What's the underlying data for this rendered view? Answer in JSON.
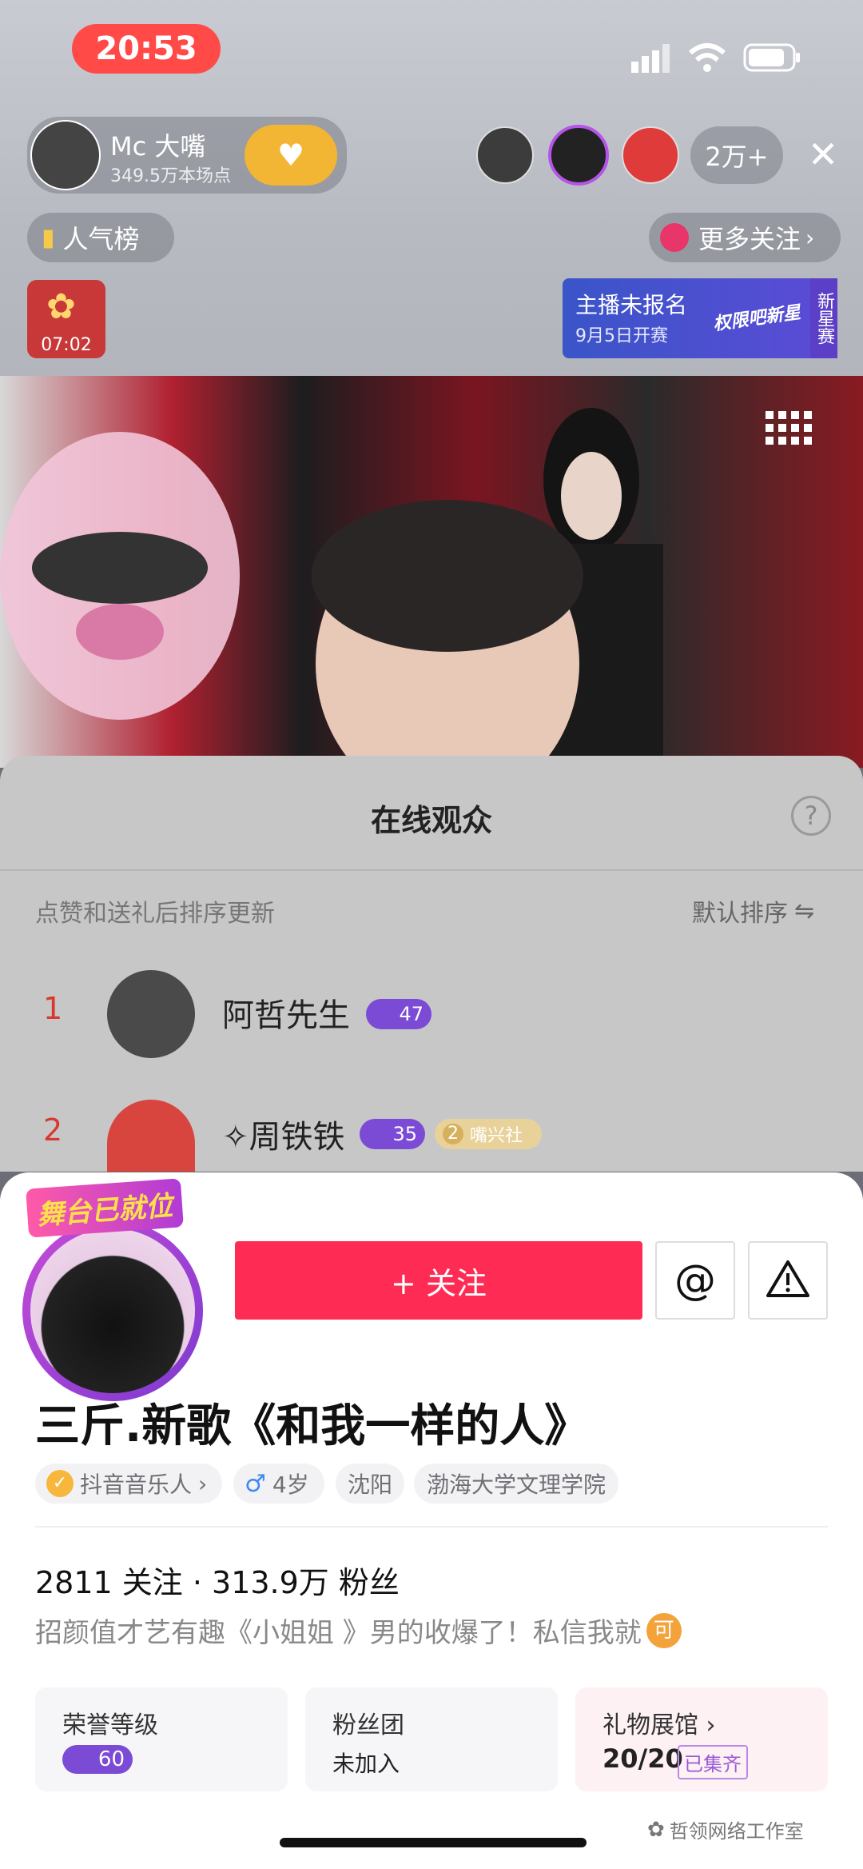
{
  "status_bar": {
    "time": "20:53"
  },
  "header": {
    "anchor_name": "Mc 大嘴",
    "anchor_stat": "349.5万本场点",
    "viewer_count": "2万+",
    "popularity_label": "人气榜",
    "more_follow_label": "更多关注",
    "timer": "07:02",
    "contest_title": "主播未报名",
    "contest_date": "9月5日开赛",
    "contest_tag": "新星赛",
    "contest_art": "权限吧新星"
  },
  "audience": {
    "title": "在线观众",
    "sort_hint": "点赞和送礼后排序更新",
    "sort_label": "默认排序",
    "rows": [
      {
        "rank": "1",
        "name": "阿哲先生",
        "level": "47"
      },
      {
        "rank": "2",
        "name": "✧周铁铁",
        "level": "35",
        "club": "2",
        "club_name": "嘴兴社"
      }
    ]
  },
  "profile": {
    "stage_badge": "舞台已就位",
    "follow_label": "+ 关注",
    "at_icon": "at-icon",
    "report_icon": "warning-icon",
    "name": "三斤.新歌《和我一样的人》",
    "tags": [
      "抖音音乐人",
      "4岁",
      "沈阳",
      "渤海大学文理学院"
    ],
    "stats": "2811 关注 · 313.9万 粉丝",
    "bio": "招颜值才艺有趣《小姐姐 》男的收爆了！私信我就",
    "bio_badge": "可",
    "cards": [
      {
        "title": "荣誉等级",
        "value": "60"
      },
      {
        "title": "粉丝团",
        "value": "未加入"
      },
      {
        "title": "礼物展馆",
        "value": "20/20",
        "badge": "已集齐"
      }
    ]
  },
  "watermark": "哲领网络工作室",
  "colors": {
    "accent": "#fe2c55",
    "time_pill": "#ff4a48",
    "level_purple": "#7b4bd6"
  }
}
